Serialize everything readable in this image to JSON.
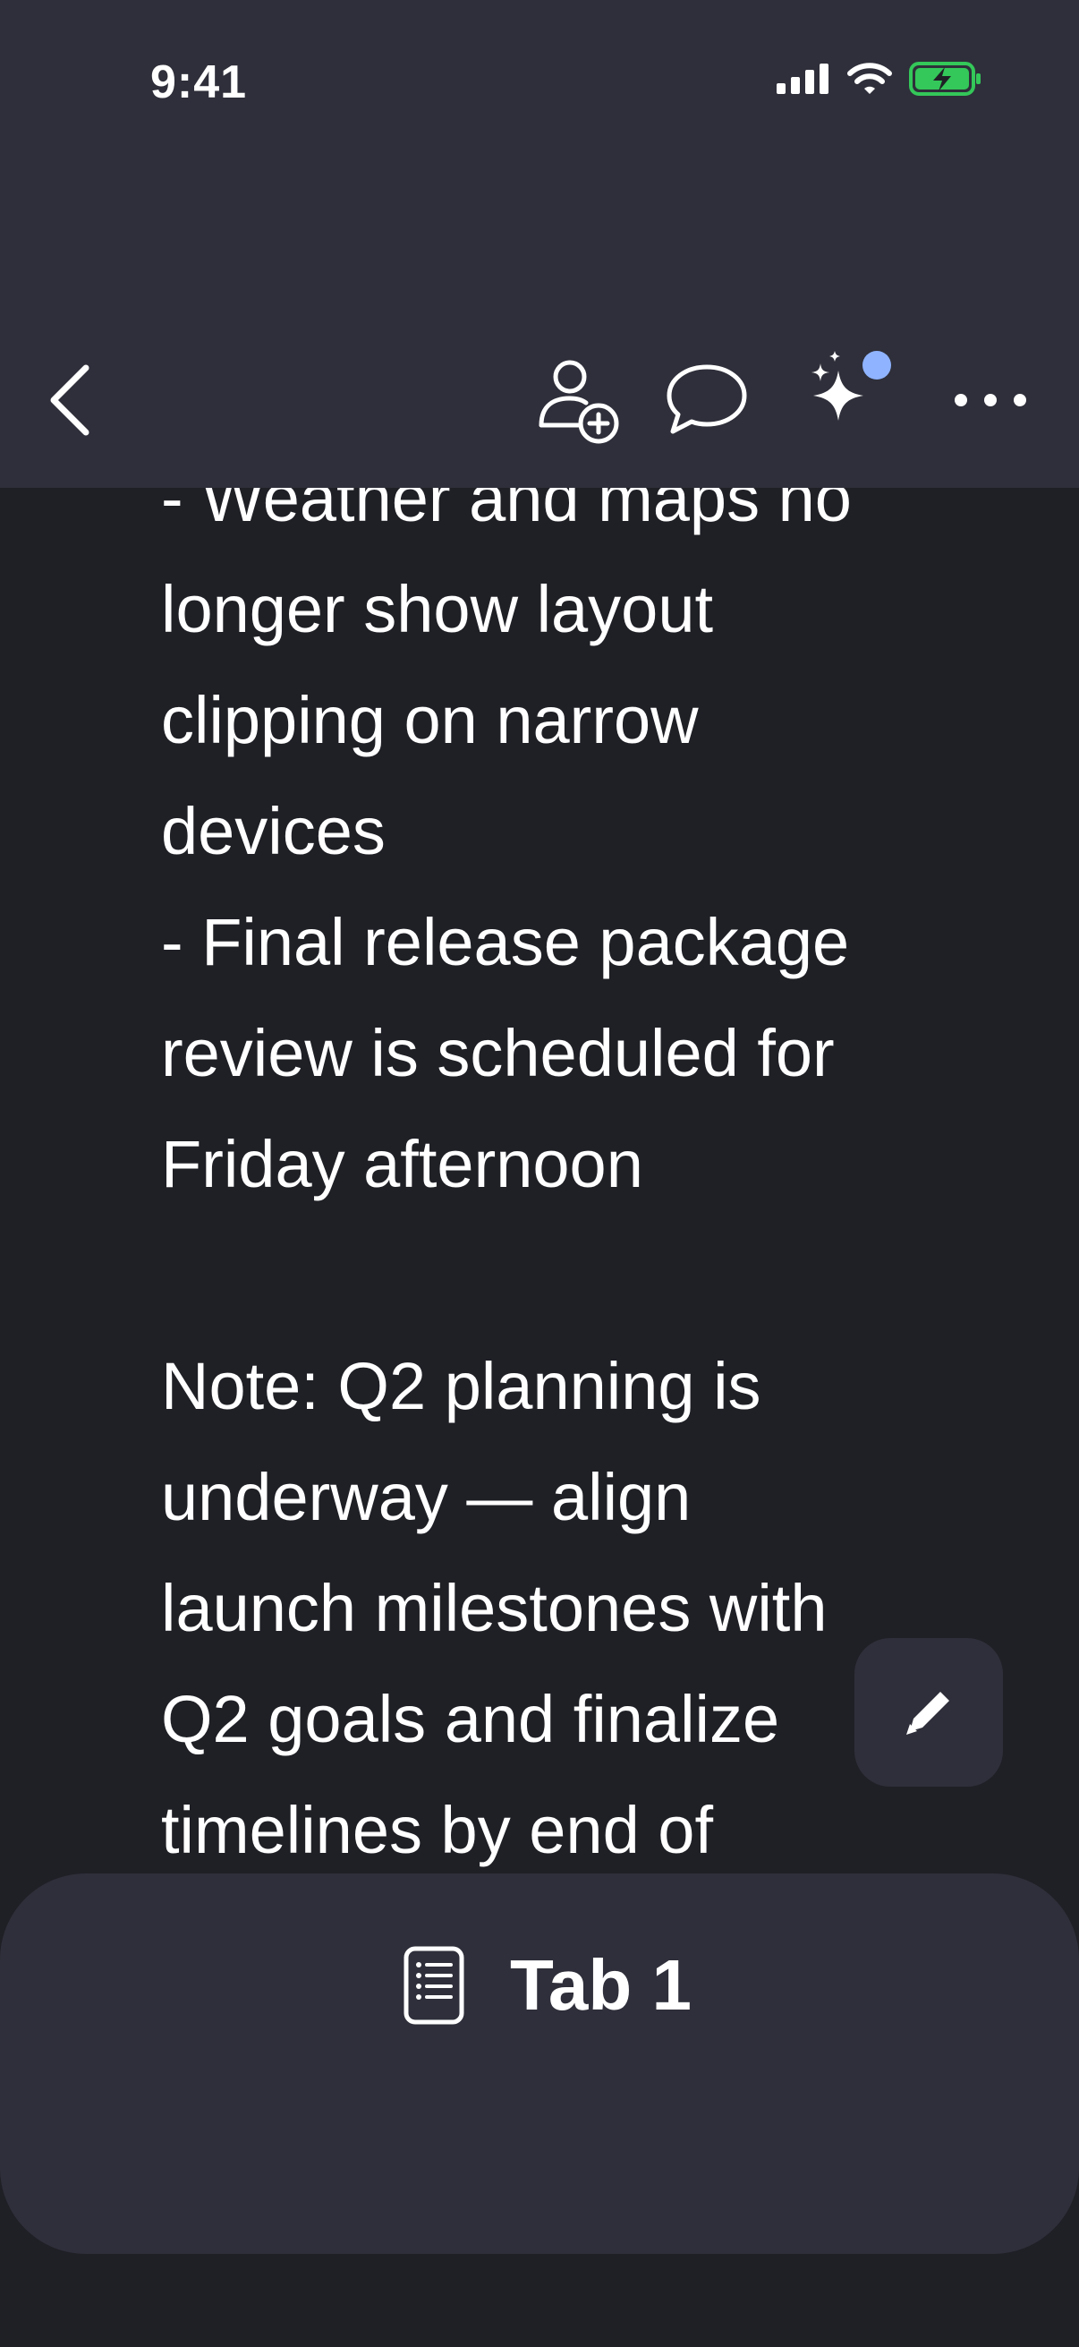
{
  "status_bar": {
    "time": "9:41"
  },
  "toolbar": {
    "icons": [
      "back-icon",
      "add-person-icon",
      "comment-icon",
      "sparkle-ai-icon",
      "more-icon"
    ],
    "ai_badge_color": "#8fb3ff"
  },
  "note": {
    "clipped_top_line": "- Weather and maps no",
    "lines": [
      "longer show layout",
      "clipping on narrow",
      "devices",
      "- Final release package",
      "review is scheduled for",
      "Friday afternoon",
      "",
      "Note: Q2 planning is",
      "underway — align",
      "launch milestones with",
      "Q2 goals and finalize",
      "timelines by end of"
    ]
  },
  "fab": {
    "icon": "pencil-icon"
  },
  "bottom_sheet": {
    "tab_icon": "document-list-icon",
    "tab_label": "Tab 1"
  },
  "colors": {
    "background": "#1f2026",
    "bar": "#2e2f3a",
    "battery_green": "#34c759"
  }
}
